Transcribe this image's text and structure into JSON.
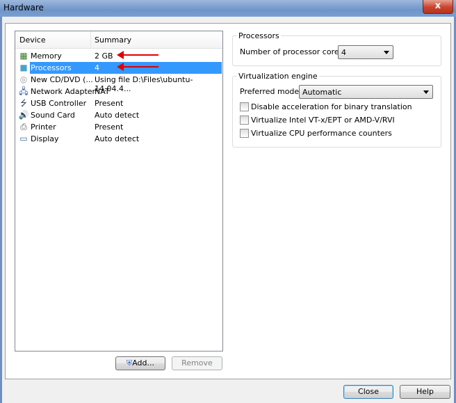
{
  "window": {
    "title": "Hardware",
    "close_glyph": "x"
  },
  "list": {
    "headers": [
      "Device",
      "Summary"
    ],
    "items": [
      {
        "name": "Memory",
        "summary": "2 GB",
        "icon": "memory-icon",
        "glyph": "▦",
        "color": "#3a7a2a"
      },
      {
        "name": "Processors",
        "summary": "4",
        "icon": "processor-icon",
        "glyph": "■",
        "color": "#4aa3c8",
        "selected": true
      },
      {
        "name": "New CD/DVD (...",
        "summary": "Using file D:\\Files\\ubuntu-14.04.4...",
        "icon": "cd-dvd-icon",
        "glyph": "◎",
        "color": "#999999"
      },
      {
        "name": "Network Adapter",
        "summary": "NAT",
        "icon": "network-icon",
        "glyph": "🖧",
        "color": "#2a5aa0"
      },
      {
        "name": "USB Controller",
        "summary": "Present",
        "icon": "usb-icon",
        "glyph": "⭍",
        "color": "#445566"
      },
      {
        "name": "Sound Card",
        "summary": "Auto detect",
        "icon": "speaker-icon",
        "glyph": "🔊",
        "color": "#2a5aa0"
      },
      {
        "name": "Printer",
        "summary": "Present",
        "icon": "printer-icon",
        "glyph": "⎙",
        "color": "#555555"
      },
      {
        "name": "Display",
        "summary": "Auto detect",
        "icon": "display-icon",
        "glyph": "▭",
        "color": "#3a6a9a"
      }
    ]
  },
  "processors": {
    "group_title": "Processors",
    "cores_label": "Number of processor cores:",
    "cores_value": "4"
  },
  "virtualization": {
    "group_title": "Virtualization engine",
    "mode_label": "Preferred mode:",
    "mode_value": "Automatic",
    "options": [
      {
        "label": "Disable acceleration for binary translation",
        "checked": false
      },
      {
        "label": "Virtualize Intel VT-x/EPT or AMD-V/RVI",
        "checked": false
      },
      {
        "label": "Virtualize CPU performance counters",
        "checked": false
      }
    ]
  },
  "buttons": {
    "add": "Add...",
    "remove": "Remove",
    "close": "Close",
    "help": "Help"
  },
  "colors": {
    "selection": "#3399ff",
    "annotation_arrow": "#e00000"
  }
}
